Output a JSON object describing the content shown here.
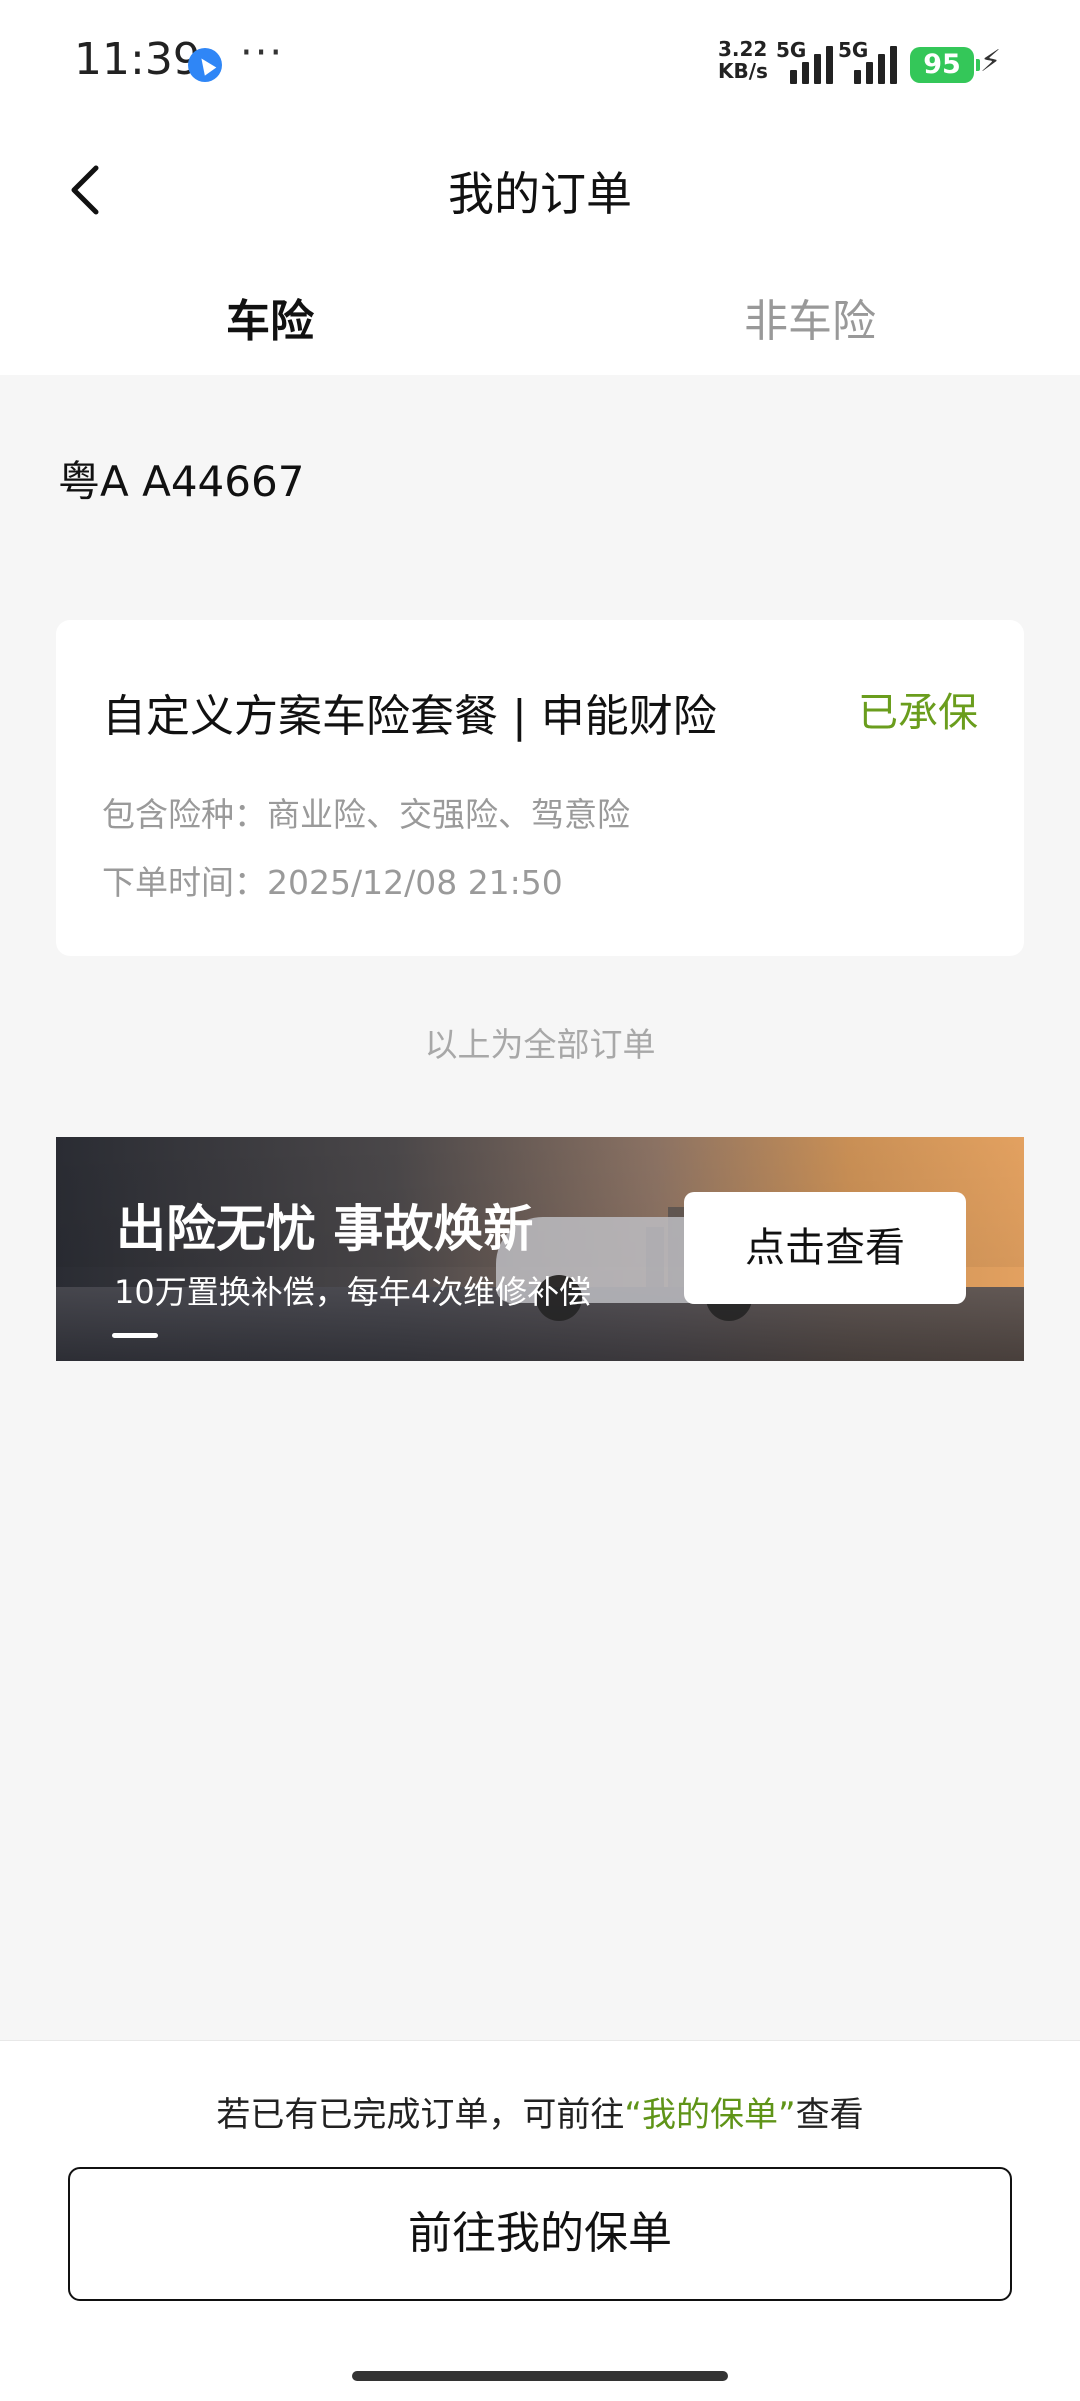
{
  "status_bar": {
    "time": "11:39",
    "net_speed_value": "3.22",
    "net_speed_unit": "KB/s",
    "signal1_label": "5G",
    "signal2_label": "5G",
    "battery": "95"
  },
  "header": {
    "title": "我的订单"
  },
  "tabs": [
    {
      "label": "车险",
      "active": true
    },
    {
      "label": "非车险",
      "active": false
    }
  ],
  "plate": "粤A A44667",
  "order": {
    "title": "自定义方案车险套餐 | 申能财险",
    "status": "已承保",
    "status_color": "#6a9d1d",
    "coverage": "包含险种：商业险、交强险、驾意险",
    "order_time": "下单时间：2025/12/08 21:50"
  },
  "end_note": "以上为全部订单",
  "banner": {
    "title": "出险无忧 事故焕新",
    "subtitle": "10万置换补偿，每年4次维修补偿",
    "button": "点击查看"
  },
  "bottom": {
    "hint_prefix": "若已有已完成订单，可前往",
    "hint_link": "“我的保单”",
    "hint_suffix": "查看",
    "button": "前往我的保单",
    "link_color": "#5f9418"
  }
}
